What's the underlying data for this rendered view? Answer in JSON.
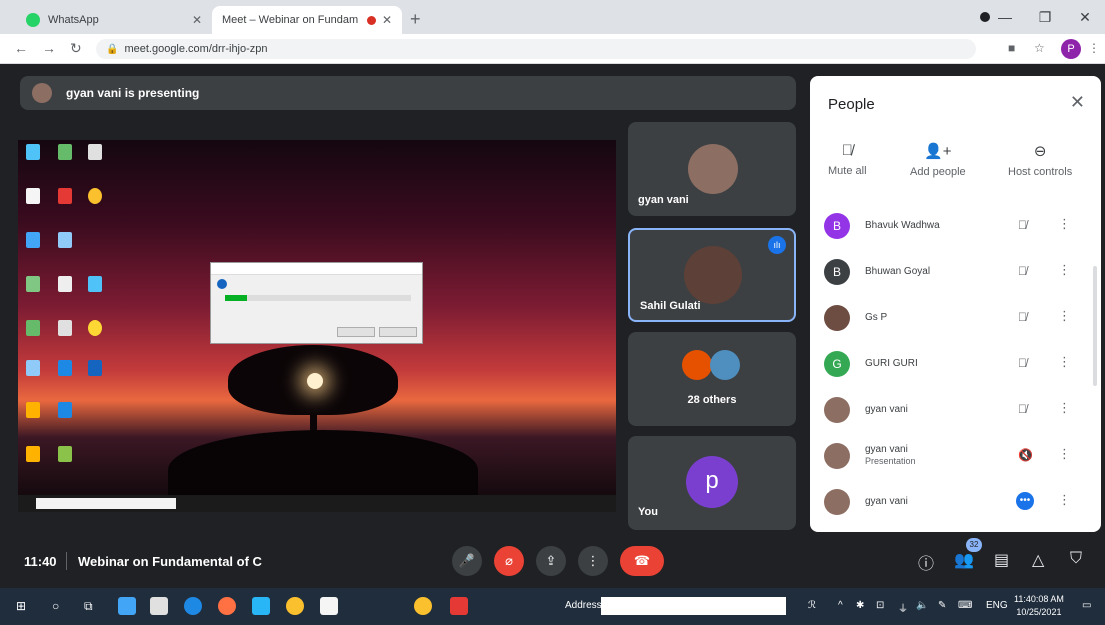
{
  "browser": {
    "tabs": [
      {
        "title": "WhatsApp",
        "active": false
      },
      {
        "title": "Meet – Webinar on Fundam",
        "active": true
      }
    ],
    "url": "meet.google.com/drr-ihjo-zpn",
    "profile_initial": "P"
  },
  "meet": {
    "presenting_text": "gyan vani is presenting",
    "tiles": {
      "presenter_name": "gyan vani",
      "speaker_name": "Sahil Gulati",
      "others_label": "28 others",
      "you_label": "You",
      "you_initial": "p"
    },
    "people_panel": {
      "title": "People",
      "controls": {
        "mute_all": "Mute all",
        "add_people": "Add people",
        "host_controls": "Host controls"
      },
      "participants": [
        {
          "name": "Bhavuk Wadhwa",
          "initial": "B",
          "color": "#9334e6"
        },
        {
          "name": "Bhuwan Goyal",
          "initial": "B",
          "color": "#3c4043"
        },
        {
          "name": "Gs P",
          "initial": "",
          "color": "#6d4c41"
        },
        {
          "name": "GURI GURI",
          "initial": "G",
          "color": "#34a853"
        },
        {
          "name": "gyan vani",
          "initial": "",
          "color": "#8d6e63"
        },
        {
          "name": "gyan vani",
          "subtitle": "Presentation",
          "initial": "",
          "color": "#8d6e63"
        },
        {
          "name": "gyan vani",
          "initial": "",
          "color": "#8d6e63"
        }
      ]
    },
    "bottom": {
      "time": "11:40",
      "meeting_title": "Webinar on Fundamental of C",
      "participant_count": "32"
    }
  },
  "taskbar": {
    "address_label": "Address",
    "lang": "ENG",
    "clock_time": "11:40:08 AM",
    "clock_date": "10/25/2021"
  },
  "colors": {
    "meet_bg": "#202124",
    "tile_bg": "#3c4043",
    "accent": "#8ab4f8",
    "end_call": "#ea4335"
  }
}
